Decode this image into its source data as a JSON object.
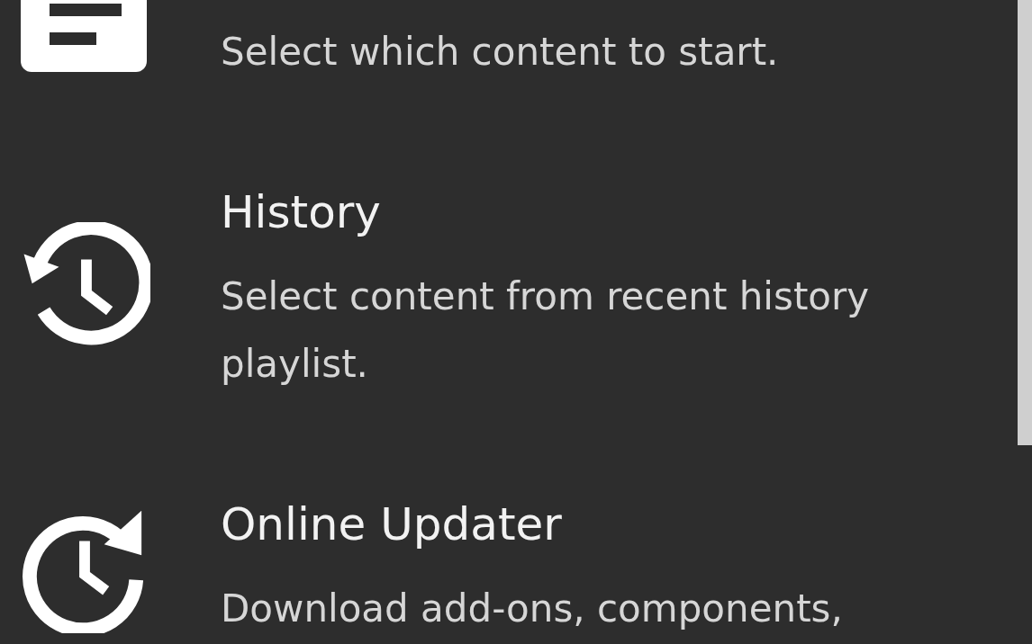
{
  "menu_items": [
    {
      "kind": "content",
      "description": "Select which content to start."
    },
    {
      "kind": "history",
      "title": "History",
      "description": "Select content from recent history playlist."
    },
    {
      "kind": "updater",
      "title": "Online Updater",
      "description": "Download add-ons, components,"
    }
  ]
}
